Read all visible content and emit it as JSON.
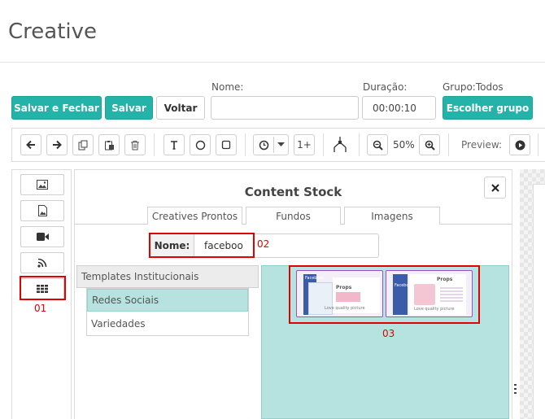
{
  "page_title": "Creative",
  "header": {
    "save_close_label": "Salvar e Fechar",
    "save_label": "Salvar",
    "back_label": "Voltar",
    "name_label": "Nome:",
    "name_value": "",
    "duration_label": "Duração:",
    "duration_value": "00:00:10",
    "group_label": "Grupo:Todos",
    "choose_group_label": "Escolher grupo"
  },
  "toolbar": {
    "repeat_label": "1+",
    "zoom_value": "50%",
    "preview_label": "Preview:"
  },
  "dialog": {
    "title": "Content Stock",
    "tabs": [
      "Creatives Prontos",
      "Fundos",
      "Imagens"
    ],
    "name_label": "Nome:",
    "name_value": "faceboo",
    "categories": {
      "header": "Templates Institucionais",
      "items": [
        "Redes Sociais",
        "Variedades"
      ]
    },
    "thumbnails": [
      {
        "badge": "Facebook",
        "text_heading": "Props",
        "caption": "Love quality picture"
      },
      {
        "badge": "Facebook",
        "text_heading": "Props",
        "caption": "Love quality picture"
      }
    ]
  },
  "annotations": [
    "01",
    "02",
    "03"
  ],
  "colors": {
    "accent": "#23b3a8",
    "highlight_red": "#e00000",
    "content_bg": "#b6e3e0",
    "thumbnail_border": "#9a52c0"
  }
}
